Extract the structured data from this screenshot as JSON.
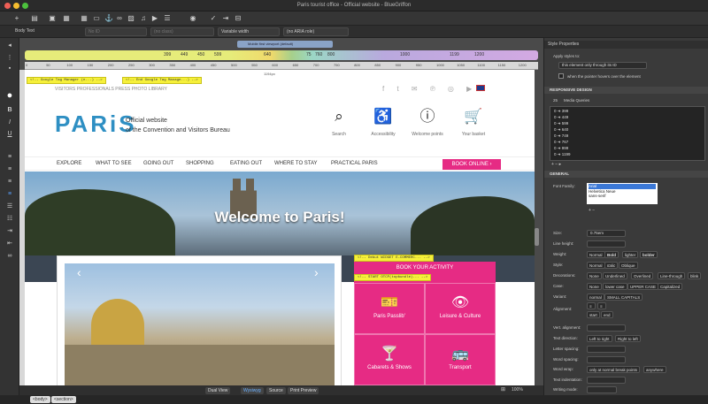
{
  "window": {
    "title": "Paris tourist office - Official website - BlueGriffon"
  },
  "propbar": {
    "style": "Body Text",
    "id": "No ID",
    "class": "(no class)",
    "width": "Variable width",
    "aria": "(no ARIA role)"
  },
  "mq": {
    "badge": "Mobile first viewport (default)",
    "labels": [
      "399",
      "449",
      "450",
      "599",
      "640",
      "75",
      "760",
      "800",
      "1000",
      "1199",
      "1200"
    ]
  },
  "ruler": {
    "numbers": [
      "0",
      "50",
      "100",
      "150",
      "200",
      "250",
      "300",
      "350",
      "400",
      "450",
      "500",
      "550",
      "600",
      "650",
      "700",
      "750",
      "800",
      "850",
      "900",
      "950",
      "1000",
      "1050",
      "1100",
      "1150",
      "1200"
    ]
  },
  "canvas": {
    "width_label": "1194px",
    "gtm_start": "<!-- Google Tag Manager (n...) -->",
    "gtm_end": "<!-- End Google Tag Manage...) -->",
    "gtm_debut": "<!-- Debut WIDGET E-COMMERC... -->",
    "gtm_start2": "<!-- START OTCP(topbundle)... -->",
    "top_tabs": "VISITORS    PROFESSIONALS    PRESS    PHOTO LIBRARY",
    "logo": "PARiS",
    "tagline1": "Official website",
    "tagline2": "of the Convention and Visitors Bureau",
    "features": [
      {
        "icon": "search-icon",
        "glyph": "⌕",
        "label": "Search"
      },
      {
        "icon": "accessibility-icon",
        "glyph": "♿",
        "label": "Accessibility"
      },
      {
        "icon": "info-icon",
        "glyph": "ⓘ",
        "label": "Welcome points"
      },
      {
        "icon": "basket-icon",
        "glyph": "🛒",
        "label": "Your basket"
      }
    ],
    "nav": [
      "EXPLORE",
      "WHAT TO SEE",
      "GOING OUT",
      "SHOPPING",
      "EATING OUT",
      "WHERE TO STAY",
      "PRACTICAL PARIS"
    ],
    "book_online": "BOOK ONLINE  ›",
    "hero_title": "Welcome to Paris!",
    "activity_title": "BOOK YOUR ACTIVITY",
    "activities": [
      {
        "icon": "ticket-icon",
        "glyph": "🎫",
        "label": "Paris Passlib'"
      },
      {
        "icon": "eye-icon",
        "glyph": "👁",
        "label": "Leisure & Culture"
      },
      {
        "icon": "cabaret-icon",
        "glyph": "🍸",
        "label": "Cabarets & Shows"
      },
      {
        "icon": "bus-icon",
        "glyph": "🚌",
        "label": "Transport"
      }
    ]
  },
  "bottombar": {
    "views": [
      "Dual View",
      "Wysiwyg",
      "Source",
      "Print Preview"
    ],
    "zoom": "100%"
  },
  "statusbar": {
    "tabs": [
      "<body>",
      "<section>"
    ]
  },
  "panel": {
    "title": "Style Properties",
    "apply_label": "Apply styles to:",
    "apply_value": "this element only through its ID",
    "hover_label": "when the pointer hovers over the element",
    "responsive": "RESPONSIVE DESIGN",
    "mq_count": "25",
    "mq_label": "Media Queries",
    "mq_rows": [
      "0 ➜ 399",
      "0 ➜ 449",
      "0 ➜ 599",
      "0 ➜ 640",
      "0 ➜ 749",
      "0 ➜ 767",
      "0 ➜ 999",
      "0 ➜ 1199"
    ],
    "general": "GENERAL",
    "font_family": "Font Family:",
    "fonts": [
      "Arial",
      "Helvetica Neue",
      "sans-serif"
    ],
    "size": "Size:",
    "size_value": "0.75em",
    "line_height": "Line height:",
    "weight": "Weight:",
    "weight_opts": [
      "Normal",
      "Bold",
      "lighter",
      "bolder"
    ],
    "style": "Style:",
    "style_opts": [
      "Normal",
      "Italic",
      "Oblique"
    ],
    "decorations": "Decorations:",
    "deco_opts": [
      "None",
      "Underlined",
      "Overlined",
      "Line-through",
      "blink"
    ],
    "case": "Case:",
    "case_opts": [
      "None",
      "lower case",
      "UPPER CASE",
      "Capitalized"
    ],
    "variant": "Variant:",
    "variant_opts": [
      "normal",
      "SMALL CAPITALS"
    ],
    "alignment": "Alignment:",
    "align_opts": [
      "start",
      "end"
    ],
    "vert_alignment": "Vert. alignment:",
    "text_direction": "Text direction:",
    "dir_opts": [
      "Left to right",
      "Right to left"
    ],
    "letter_spacing": "Letter spacing:",
    "word_spacing": "Word spacing:",
    "word_wrap": "Word wrap:",
    "wrap_opts": [
      "only at normal break points",
      "anywhere"
    ],
    "text_indent": "Text indentation:",
    "writing_mode": "Writing mode:"
  }
}
